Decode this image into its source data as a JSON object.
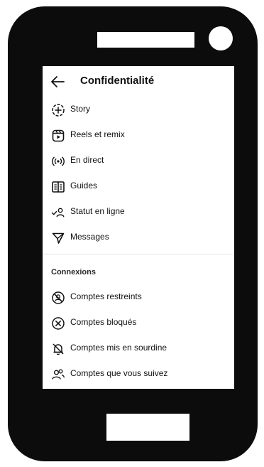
{
  "header": {
    "back_icon": "arrow-left-icon",
    "title": "Confidentialité"
  },
  "items": [
    {
      "label": "Story",
      "icon": "story-add-icon"
    },
    {
      "label": "Reels et remix",
      "icon": "reels-icon"
    },
    {
      "label": "En direct",
      "icon": "live-icon"
    },
    {
      "label": "Guides",
      "icon": "guides-icon"
    },
    {
      "label": "Statut en ligne",
      "icon": "online-status-icon"
    },
    {
      "label": "Messages",
      "icon": "messages-icon"
    }
  ],
  "connections": {
    "title": "Connexions",
    "items": [
      {
        "label": "Comptes restreints",
        "icon": "restricted-icon"
      },
      {
        "label": "Comptes bloqués",
        "icon": "blocked-icon"
      },
      {
        "label": "Comptes mis en sourdine",
        "icon": "muted-icon"
      },
      {
        "label": "Comptes que vous suivez",
        "icon": "following-icon"
      }
    ]
  }
}
